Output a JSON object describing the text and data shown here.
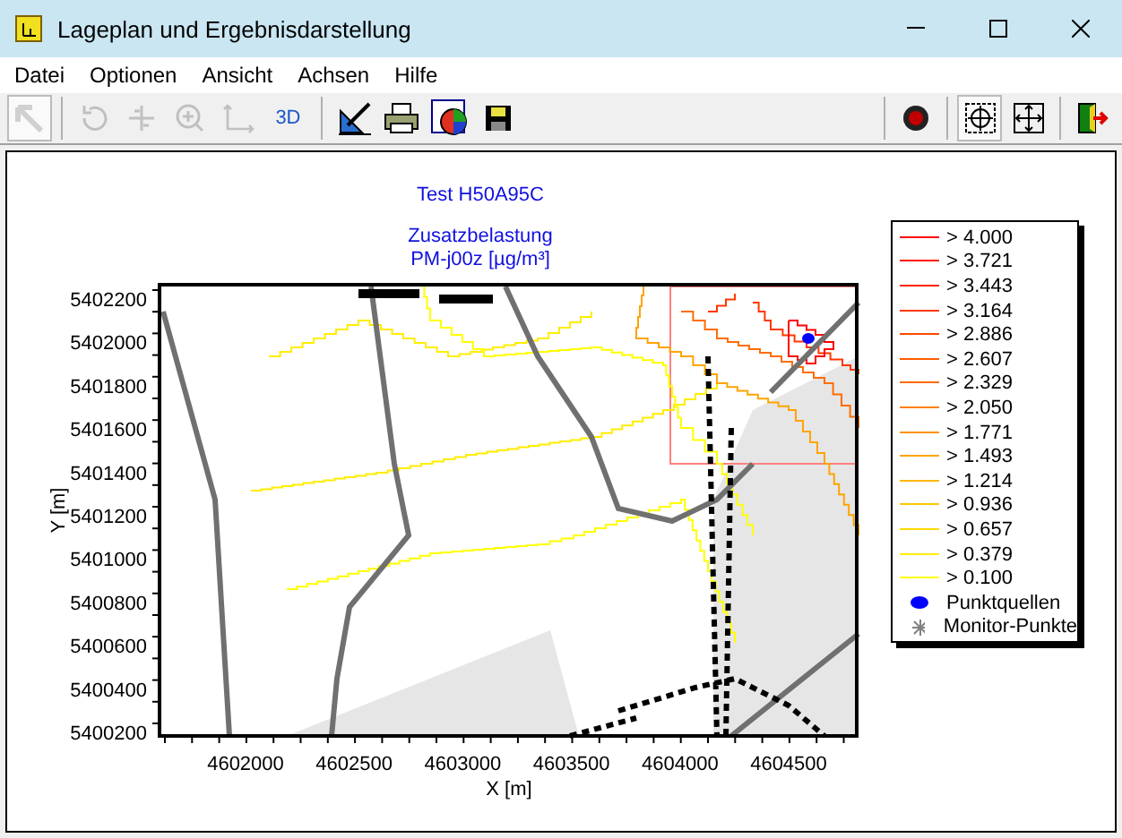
{
  "window": {
    "title": "Lageplan und Ergebnisdarstellung"
  },
  "menu": [
    "Datei",
    "Optionen",
    "Ansicht",
    "Achsen",
    "Hilfe"
  ],
  "toolbar": [
    {
      "kind": "pointer",
      "disabled": true
    },
    {
      "kind": "rotate",
      "disabled": true
    },
    {
      "kind": "move",
      "disabled": true
    },
    {
      "kind": "zoom",
      "disabled": true
    },
    {
      "kind": "axes",
      "disabled": true
    },
    {
      "kind": "text",
      "label": "3D"
    },
    {
      "kind": "ruler"
    },
    {
      "kind": "printer"
    },
    {
      "kind": "piechart"
    },
    {
      "kind": "save"
    },
    {
      "kind": "record"
    },
    {
      "kind": "fit",
      "selected": true
    },
    {
      "kind": "expand",
      "selected": false
    },
    {
      "kind": "exit"
    }
  ],
  "plot": {
    "title": "Test H50A95C",
    "subtitle": [
      "Zusatzbelastung",
      "PM-j00z [µg/m³]"
    ],
    "xlabel": "X [m]",
    "ylabel": "Y [m]",
    "xticks": [
      "4602000",
      "4602500",
      "4603000",
      "4603500",
      "4604000",
      "4604500"
    ],
    "yticks": [
      "5402200",
      "5402000",
      "5401800",
      "5401600",
      "5401400",
      "5401200",
      "5401000",
      "5400800",
      "5400600",
      "5400400",
      "5400200"
    ]
  },
  "legend": [
    {
      "kind": "line",
      "label": "> 4.000",
      "color": "#ff0000"
    },
    {
      "kind": "line",
      "label": "> 3.721",
      "color": "#ff1200"
    },
    {
      "kind": "line",
      "label": "> 3.443",
      "color": "#ff2400"
    },
    {
      "kind": "line",
      "label": "> 3.164",
      "color": "#ff3700"
    },
    {
      "kind": "line",
      "label": "> 2.886",
      "color": "#ff4900"
    },
    {
      "kind": "line",
      "label": "> 2.607",
      "color": "#ff5b00"
    },
    {
      "kind": "line",
      "label": "> 2.329",
      "color": "#ff6d00"
    },
    {
      "kind": "line",
      "label": "> 2.050",
      "color": "#ff8000"
    },
    {
      "kind": "line",
      "label": "> 1.771",
      "color": "#ff9200"
    },
    {
      "kind": "line",
      "label": "> 1.493",
      "color": "#ffa400"
    },
    {
      "kind": "line",
      "label": "> 1.214",
      "color": "#ffb600"
    },
    {
      "kind": "line",
      "label": "> 0.936",
      "color": "#ffc800"
    },
    {
      "kind": "line",
      "label": "> 0.657",
      "color": "#ffdb00"
    },
    {
      "kind": "line",
      "label": "> 0.379",
      "color": "#ffed00"
    },
    {
      "kind": "line",
      "label": "> 0.100",
      "color": "#ffff00"
    },
    {
      "kind": "point",
      "label": "Punktquellen",
      "color": "#0000ff"
    },
    {
      "kind": "star",
      "label": "Monitor-Punkte",
      "color": "#808080"
    }
  ]
}
